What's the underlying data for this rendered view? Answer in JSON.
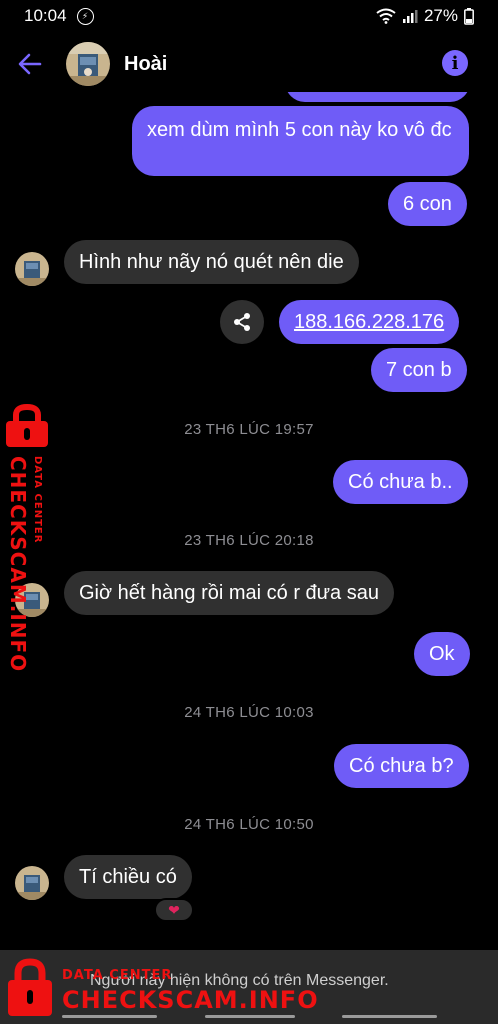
{
  "status_bar": {
    "time": "10:04",
    "battery": "27%"
  },
  "header": {
    "contact_name": "Hoài"
  },
  "messages": [
    {
      "text": "xem dùm mình 5 con này ko vô đc"
    },
    {
      "text": "6 con"
    },
    {
      "text": "Hình như nãy nó quét nên die"
    },
    {
      "text": "188.166.228.176"
    },
    {
      "text": "7 con b"
    },
    {
      "text": "Có chưa b.."
    },
    {
      "text": "Giờ hết hàng rồi mai có r đưa sau"
    },
    {
      "text": "Ok"
    },
    {
      "text": "Có chưa b?"
    },
    {
      "text": "Tí chiều có"
    }
  ],
  "timestamps": [
    "23 TH6 LÚC 19:57",
    "23 TH6 LÚC 20:18",
    "24 TH6 LÚC 10:03",
    "24 TH6 LÚC 10:50"
  ],
  "reaction": "❤",
  "footer": {
    "notice": "Người này hiện không có trên Messenger."
  },
  "watermark": {
    "small": "DATA CENTER",
    "big": "CHECKSCAM.INFO"
  },
  "icons": {
    "messenger": "messenger-icon",
    "wifi": "wifi-icon",
    "signal": "signal-icon",
    "battery": "battery-icon",
    "back": "back-arrow-icon",
    "info": "info-icon",
    "share": "share-icon",
    "lock": "lock-icon"
  },
  "colors": {
    "accent": "#6f5cf7",
    "incoming": "#303030",
    "background": "#000000",
    "watermark": "#e11111"
  }
}
